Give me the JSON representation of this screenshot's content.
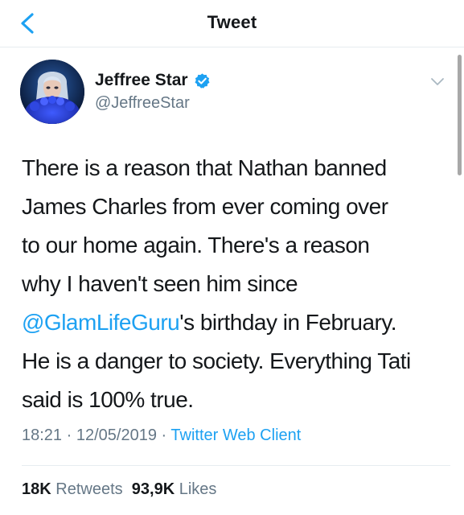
{
  "nav": {
    "title": "Tweet",
    "back_icon": "chevron-left-icon"
  },
  "author": {
    "name": "Jeffree Star",
    "handle": "@JeffreeStar",
    "verified": true,
    "verified_icon": "verified-badge-icon"
  },
  "tweet": {
    "lines": [
      [
        "There is a reason that Nathan banned"
      ],
      [
        "James Charles from ever coming over"
      ],
      [
        "to our home again. There's a reason"
      ],
      [
        "why I haven't seen him since"
      ],
      [
        "@GlamLifeGuru",
        "'s birthday in February."
      ],
      [
        "He is a danger to society. Everything Tati"
      ],
      [
        "said is 100% true."
      ]
    ],
    "mention": "@GlamLifeGuru"
  },
  "meta": {
    "time": "18:21",
    "date": "12/05/2019",
    "separator": "·",
    "client": "Twitter Web Client"
  },
  "stats": {
    "retweets_count": "18K",
    "retweets_label": "Retweets",
    "likes_count": "93,9K",
    "likes_label": "Likes"
  },
  "colors": {
    "accent": "#1da1f2",
    "text": "#14171a",
    "secondary": "#657786",
    "divider": "#e6ecf0"
  }
}
